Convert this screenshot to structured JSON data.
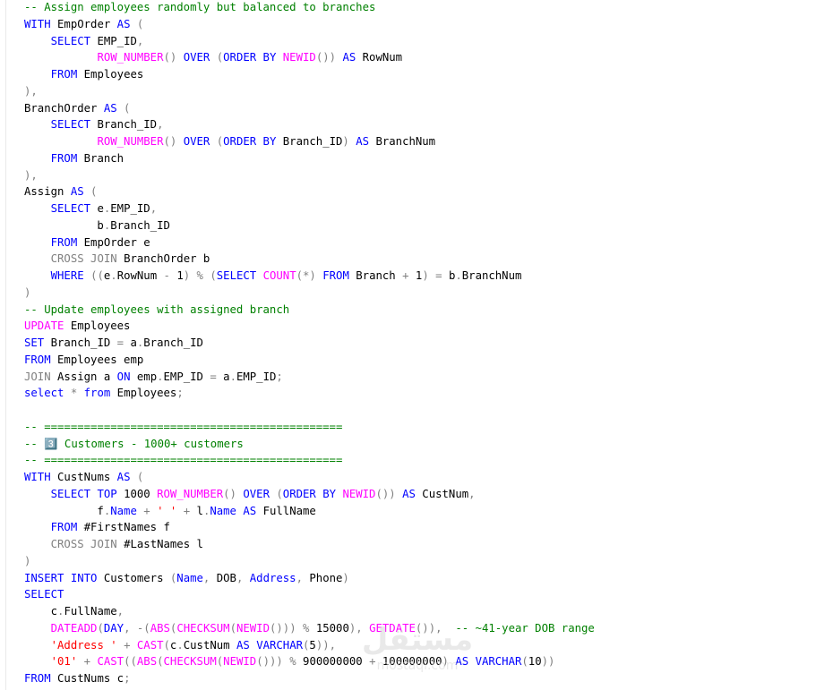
{
  "colors": {
    "comment": "#008000",
    "keyword": "#0000ff",
    "function": "#ff00ff",
    "gray": "#808080",
    "string": "#ff0000",
    "text": "#000000"
  },
  "lines": [
    [
      {
        "c": "comment",
        "t": "-- Assign employees randomly but balanced to branches"
      }
    ],
    [
      {
        "c": "keyword",
        "t": "WITH"
      },
      {
        "c": "text",
        "t": " EmpOrder "
      },
      {
        "c": "keyword",
        "t": "AS"
      },
      {
        "c": "gray",
        "t": " ("
      }
    ],
    [
      {
        "c": "text",
        "t": "    "
      },
      {
        "c": "keyword",
        "t": "SELECT"
      },
      {
        "c": "text",
        "t": " EMP_ID"
      },
      {
        "c": "gray",
        "t": ","
      }
    ],
    [
      {
        "c": "text",
        "t": "           "
      },
      {
        "c": "function",
        "t": "ROW_NUMBER"
      },
      {
        "c": "gray",
        "t": "()"
      },
      {
        "c": "text",
        "t": " "
      },
      {
        "c": "keyword",
        "t": "OVER"
      },
      {
        "c": "text",
        "t": " "
      },
      {
        "c": "gray",
        "t": "("
      },
      {
        "c": "keyword",
        "t": "ORDER BY"
      },
      {
        "c": "text",
        "t": " "
      },
      {
        "c": "function",
        "t": "NEWID"
      },
      {
        "c": "gray",
        "t": "())"
      },
      {
        "c": "text",
        "t": " "
      },
      {
        "c": "keyword",
        "t": "AS"
      },
      {
        "c": "text",
        "t": " RowNum"
      }
    ],
    [
      {
        "c": "text",
        "t": "    "
      },
      {
        "c": "keyword",
        "t": "FROM"
      },
      {
        "c": "text",
        "t": " Employees"
      }
    ],
    [
      {
        "c": "gray",
        "t": "),"
      }
    ],
    [
      {
        "c": "text",
        "t": "BranchOrder "
      },
      {
        "c": "keyword",
        "t": "AS"
      },
      {
        "c": "gray",
        "t": " ("
      }
    ],
    [
      {
        "c": "text",
        "t": "    "
      },
      {
        "c": "keyword",
        "t": "SELECT"
      },
      {
        "c": "text",
        "t": " Branch_ID"
      },
      {
        "c": "gray",
        "t": ","
      }
    ],
    [
      {
        "c": "text",
        "t": "           "
      },
      {
        "c": "function",
        "t": "ROW_NUMBER"
      },
      {
        "c": "gray",
        "t": "()"
      },
      {
        "c": "text",
        "t": " "
      },
      {
        "c": "keyword",
        "t": "OVER"
      },
      {
        "c": "text",
        "t": " "
      },
      {
        "c": "gray",
        "t": "("
      },
      {
        "c": "keyword",
        "t": "ORDER BY"
      },
      {
        "c": "text",
        "t": " Branch_ID"
      },
      {
        "c": "gray",
        "t": ")"
      },
      {
        "c": "text",
        "t": " "
      },
      {
        "c": "keyword",
        "t": "AS"
      },
      {
        "c": "text",
        "t": " BranchNum"
      }
    ],
    [
      {
        "c": "text",
        "t": "    "
      },
      {
        "c": "keyword",
        "t": "FROM"
      },
      {
        "c": "text",
        "t": " Branch"
      }
    ],
    [
      {
        "c": "gray",
        "t": "),"
      }
    ],
    [
      {
        "c": "text",
        "t": "Assign "
      },
      {
        "c": "keyword",
        "t": "AS"
      },
      {
        "c": "gray",
        "t": " ("
      }
    ],
    [
      {
        "c": "text",
        "t": "    "
      },
      {
        "c": "keyword",
        "t": "SELECT"
      },
      {
        "c": "text",
        "t": " e"
      },
      {
        "c": "gray",
        "t": "."
      },
      {
        "c": "text",
        "t": "EMP_ID"
      },
      {
        "c": "gray",
        "t": ","
      }
    ],
    [
      {
        "c": "text",
        "t": "           b"
      },
      {
        "c": "gray",
        "t": "."
      },
      {
        "c": "text",
        "t": "Branch_ID"
      }
    ],
    [
      {
        "c": "text",
        "t": "    "
      },
      {
        "c": "keyword",
        "t": "FROM"
      },
      {
        "c": "text",
        "t": " EmpOrder e"
      }
    ],
    [
      {
        "c": "text",
        "t": "    "
      },
      {
        "c": "gray",
        "t": "CROSS JOIN"
      },
      {
        "c": "text",
        "t": " BranchOrder b"
      }
    ],
    [
      {
        "c": "text",
        "t": "    "
      },
      {
        "c": "keyword",
        "t": "WHERE"
      },
      {
        "c": "text",
        "t": " "
      },
      {
        "c": "gray",
        "t": "(("
      },
      {
        "c": "text",
        "t": "e"
      },
      {
        "c": "gray",
        "t": "."
      },
      {
        "c": "text",
        "t": "RowNum "
      },
      {
        "c": "gray",
        "t": "-"
      },
      {
        "c": "text",
        "t": " 1"
      },
      {
        "c": "gray",
        "t": ")"
      },
      {
        "c": "text",
        "t": " "
      },
      {
        "c": "gray",
        "t": "%"
      },
      {
        "c": "text",
        "t": " "
      },
      {
        "c": "gray",
        "t": "("
      },
      {
        "c": "keyword",
        "t": "SELECT"
      },
      {
        "c": "text",
        "t": " "
      },
      {
        "c": "function",
        "t": "COUNT"
      },
      {
        "c": "gray",
        "t": "(*)"
      },
      {
        "c": "text",
        "t": " "
      },
      {
        "c": "keyword",
        "t": "FROM"
      },
      {
        "c": "text",
        "t": " Branch "
      },
      {
        "c": "gray",
        "t": "+"
      },
      {
        "c": "text",
        "t": " 1"
      },
      {
        "c": "gray",
        "t": ")"
      },
      {
        "c": "text",
        "t": " "
      },
      {
        "c": "gray",
        "t": "="
      },
      {
        "c": "text",
        "t": " b"
      },
      {
        "c": "gray",
        "t": "."
      },
      {
        "c": "text",
        "t": "BranchNum"
      }
    ],
    [
      {
        "c": "gray",
        "t": ")"
      }
    ],
    [
      {
        "c": "comment",
        "t": "-- Update employees with assigned branch"
      }
    ],
    [
      {
        "c": "function",
        "t": "UPDATE"
      },
      {
        "c": "text",
        "t": " Employees"
      }
    ],
    [
      {
        "c": "keyword",
        "t": "SET"
      },
      {
        "c": "text",
        "t": " Branch_ID "
      },
      {
        "c": "gray",
        "t": "="
      },
      {
        "c": "text",
        "t": " a"
      },
      {
        "c": "gray",
        "t": "."
      },
      {
        "c": "text",
        "t": "Branch_ID"
      }
    ],
    [
      {
        "c": "keyword",
        "t": "FROM"
      },
      {
        "c": "text",
        "t": " Employees emp"
      }
    ],
    [
      {
        "c": "gray",
        "t": "JOIN"
      },
      {
        "c": "text",
        "t": " Assign a "
      },
      {
        "c": "keyword",
        "t": "ON"
      },
      {
        "c": "text",
        "t": " emp"
      },
      {
        "c": "gray",
        "t": "."
      },
      {
        "c": "text",
        "t": "EMP_ID "
      },
      {
        "c": "gray",
        "t": "="
      },
      {
        "c": "text",
        "t": " a"
      },
      {
        "c": "gray",
        "t": "."
      },
      {
        "c": "text",
        "t": "EMP_ID"
      },
      {
        "c": "gray",
        "t": ";"
      }
    ],
    [
      {
        "c": "keyword",
        "t": "select"
      },
      {
        "c": "text",
        "t": " "
      },
      {
        "c": "gray",
        "t": "*"
      },
      {
        "c": "text",
        "t": " "
      },
      {
        "c": "keyword",
        "t": "from"
      },
      {
        "c": "text",
        "t": " Employees"
      },
      {
        "c": "gray",
        "t": ";"
      }
    ],
    [],
    [
      {
        "c": "comment",
        "t": "-- ============================================="
      }
    ],
    [
      {
        "c": "comment",
        "t": "-- 3️⃣ Customers - 1000+ customers"
      }
    ],
    [
      {
        "c": "comment",
        "t": "-- ============================================="
      }
    ],
    [
      {
        "c": "keyword",
        "t": "WITH"
      },
      {
        "c": "text",
        "t": " CustNums "
      },
      {
        "c": "keyword",
        "t": "AS"
      },
      {
        "c": "gray",
        "t": " ("
      }
    ],
    [
      {
        "c": "text",
        "t": "    "
      },
      {
        "c": "keyword",
        "t": "SELECT"
      },
      {
        "c": "text",
        "t": " "
      },
      {
        "c": "keyword",
        "t": "TOP"
      },
      {
        "c": "text",
        "t": " 1000 "
      },
      {
        "c": "function",
        "t": "ROW_NUMBER"
      },
      {
        "c": "gray",
        "t": "()"
      },
      {
        "c": "text",
        "t": " "
      },
      {
        "c": "keyword",
        "t": "OVER"
      },
      {
        "c": "text",
        "t": " "
      },
      {
        "c": "gray",
        "t": "("
      },
      {
        "c": "keyword",
        "t": "ORDER BY"
      },
      {
        "c": "text",
        "t": " "
      },
      {
        "c": "function",
        "t": "NEWID"
      },
      {
        "c": "gray",
        "t": "())"
      },
      {
        "c": "text",
        "t": " "
      },
      {
        "c": "keyword",
        "t": "AS"
      },
      {
        "c": "text",
        "t": " CustNum"
      },
      {
        "c": "gray",
        "t": ","
      }
    ],
    [
      {
        "c": "text",
        "t": "           f"
      },
      {
        "c": "gray",
        "t": "."
      },
      {
        "c": "keyword",
        "t": "Name"
      },
      {
        "c": "text",
        "t": " "
      },
      {
        "c": "gray",
        "t": "+"
      },
      {
        "c": "text",
        "t": " "
      },
      {
        "c": "string",
        "t": "' '"
      },
      {
        "c": "text",
        "t": " "
      },
      {
        "c": "gray",
        "t": "+"
      },
      {
        "c": "text",
        "t": " l"
      },
      {
        "c": "gray",
        "t": "."
      },
      {
        "c": "keyword",
        "t": "Name"
      },
      {
        "c": "text",
        "t": " "
      },
      {
        "c": "keyword",
        "t": "AS"
      },
      {
        "c": "text",
        "t": " FullName"
      }
    ],
    [
      {
        "c": "text",
        "t": "    "
      },
      {
        "c": "keyword",
        "t": "FROM"
      },
      {
        "c": "text",
        "t": " #FirstNames f"
      }
    ],
    [
      {
        "c": "text",
        "t": "    "
      },
      {
        "c": "gray",
        "t": "CROSS JOIN"
      },
      {
        "c": "text",
        "t": " #LastNames l"
      }
    ],
    [
      {
        "c": "gray",
        "t": ")"
      }
    ],
    [
      {
        "c": "keyword",
        "t": "INSERT"
      },
      {
        "c": "text",
        "t": " "
      },
      {
        "c": "keyword",
        "t": "INTO"
      },
      {
        "c": "text",
        "t": " Customers "
      },
      {
        "c": "gray",
        "t": "("
      },
      {
        "c": "keyword",
        "t": "Name"
      },
      {
        "c": "gray",
        "t": ","
      },
      {
        "c": "text",
        "t": " DOB"
      },
      {
        "c": "gray",
        "t": ","
      },
      {
        "c": "text",
        "t": " "
      },
      {
        "c": "keyword",
        "t": "Address"
      },
      {
        "c": "gray",
        "t": ","
      },
      {
        "c": "text",
        "t": " Phone"
      },
      {
        "c": "gray",
        "t": ")"
      }
    ],
    [
      {
        "c": "keyword",
        "t": "SELECT"
      }
    ],
    [
      {
        "c": "text",
        "t": "    c"
      },
      {
        "c": "gray",
        "t": "."
      },
      {
        "c": "text",
        "t": "FullName"
      },
      {
        "c": "gray",
        "t": ","
      }
    ],
    [
      {
        "c": "text",
        "t": "    "
      },
      {
        "c": "function",
        "t": "DATEADD"
      },
      {
        "c": "gray",
        "t": "("
      },
      {
        "c": "keyword",
        "t": "DAY"
      },
      {
        "c": "gray",
        "t": ","
      },
      {
        "c": "text",
        "t": " "
      },
      {
        "c": "gray",
        "t": "-("
      },
      {
        "c": "function",
        "t": "ABS"
      },
      {
        "c": "gray",
        "t": "("
      },
      {
        "c": "function",
        "t": "CHECKSUM"
      },
      {
        "c": "gray",
        "t": "("
      },
      {
        "c": "function",
        "t": "NEWID"
      },
      {
        "c": "gray",
        "t": "()))"
      },
      {
        "c": "text",
        "t": " "
      },
      {
        "c": "gray",
        "t": "%"
      },
      {
        "c": "text",
        "t": " 15000"
      },
      {
        "c": "gray",
        "t": "),"
      },
      {
        "c": "text",
        "t": " "
      },
      {
        "c": "function",
        "t": "GETDATE"
      },
      {
        "c": "gray",
        "t": "()),"
      },
      {
        "c": "text",
        "t": "  "
      },
      {
        "c": "comment",
        "t": "-- ~41-year DOB range"
      }
    ],
    [
      {
        "c": "text",
        "t": "    "
      },
      {
        "c": "string",
        "t": "'Address '"
      },
      {
        "c": "text",
        "t": " "
      },
      {
        "c": "gray",
        "t": "+"
      },
      {
        "c": "text",
        "t": " "
      },
      {
        "c": "function",
        "t": "CAST"
      },
      {
        "c": "gray",
        "t": "("
      },
      {
        "c": "text",
        "t": "c"
      },
      {
        "c": "gray",
        "t": "."
      },
      {
        "c": "text",
        "t": "CustNum "
      },
      {
        "c": "keyword",
        "t": "AS"
      },
      {
        "c": "text",
        "t": " "
      },
      {
        "c": "keyword",
        "t": "VARCHAR"
      },
      {
        "c": "gray",
        "t": "("
      },
      {
        "c": "text",
        "t": "5"
      },
      {
        "c": "gray",
        "t": ")),"
      }
    ],
    [
      {
        "c": "text",
        "t": "    "
      },
      {
        "c": "string",
        "t": "'01'"
      },
      {
        "c": "text",
        "t": " "
      },
      {
        "c": "gray",
        "t": "+"
      },
      {
        "c": "text",
        "t": " "
      },
      {
        "c": "function",
        "t": "CAST"
      },
      {
        "c": "gray",
        "t": "(("
      },
      {
        "c": "function",
        "t": "ABS"
      },
      {
        "c": "gray",
        "t": "("
      },
      {
        "c": "function",
        "t": "CHECKSUM"
      },
      {
        "c": "gray",
        "t": "("
      },
      {
        "c": "function",
        "t": "NEWID"
      },
      {
        "c": "gray",
        "t": "()))"
      },
      {
        "c": "text",
        "t": " "
      },
      {
        "c": "gray",
        "t": "%"
      },
      {
        "c": "text",
        "t": " 900000000 "
      },
      {
        "c": "gray",
        "t": "+"
      },
      {
        "c": "text",
        "t": " 100000000"
      },
      {
        "c": "gray",
        "t": ")"
      },
      {
        "c": "text",
        "t": " "
      },
      {
        "c": "keyword",
        "t": "AS"
      },
      {
        "c": "text",
        "t": " "
      },
      {
        "c": "keyword",
        "t": "VARCHAR"
      },
      {
        "c": "gray",
        "t": "("
      },
      {
        "c": "text",
        "t": "10"
      },
      {
        "c": "gray",
        "t": "))"
      }
    ],
    [
      {
        "c": "keyword",
        "t": "FROM"
      },
      {
        "c": "text",
        "t": " CustNums c"
      },
      {
        "c": "gray",
        "t": ";"
      }
    ]
  ],
  "watermark": {
    "brand": "مستقل",
    "domain": "mostaql.com"
  }
}
